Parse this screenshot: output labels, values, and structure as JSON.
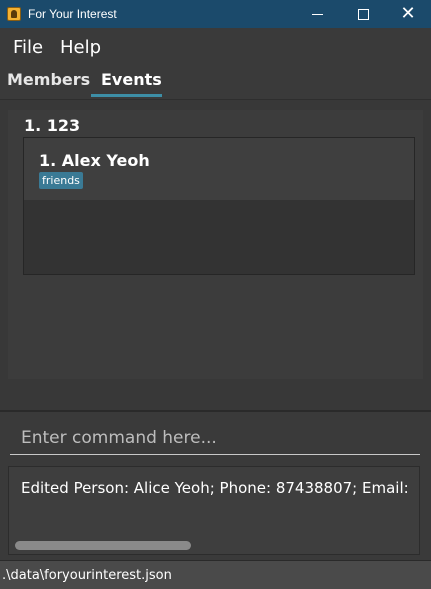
{
  "window": {
    "title": "For Your Interest",
    "icon": "app-icon",
    "controls": {
      "minimize": "minimize-icon",
      "maximize": "maximize-icon",
      "close": "close-icon"
    }
  },
  "menu": {
    "items": [
      {
        "label": "File"
      },
      {
        "label": "Help"
      }
    ]
  },
  "tabs": {
    "items": [
      {
        "label": "Members"
      },
      {
        "label": "Events"
      }
    ],
    "active": "Events"
  },
  "events": [
    {
      "index_label": "1.  123",
      "members": [
        {
          "name_label": "1.  Alex Yeoh",
          "tags": [
            "friends"
          ]
        }
      ]
    }
  ],
  "command": {
    "placeholder": "Enter command here..."
  },
  "result": {
    "text": "Edited Person: Alice Yeoh; Phone: 87438807; Email:"
  },
  "status": {
    "path": ".\\data\\foryourinterest.json"
  },
  "colors": {
    "titlebar": "#1b4a6b",
    "accent": "#3d8ea6",
    "tag": "#3a7a95",
    "background": "#3a3a3a"
  }
}
